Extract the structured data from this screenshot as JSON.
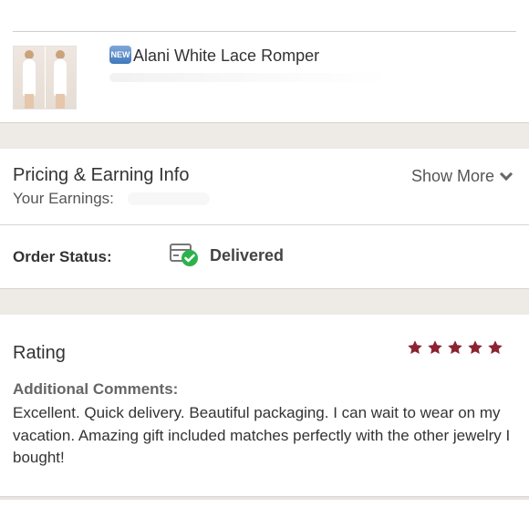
{
  "product": {
    "badge": "NEW",
    "title": "Alani White Lace Romper"
  },
  "pricing": {
    "title": "Pricing & Earning Info",
    "earnings_label": "Your Earnings:",
    "show_more_label": "Show More"
  },
  "order": {
    "status_label": "Order Status:",
    "status_value": "Delivered",
    "status_icon": "package-delivered-icon",
    "status_color": "#2bb24c"
  },
  "rating": {
    "title": "Rating",
    "stars": 5,
    "max_stars": 5,
    "star_color": "#8b2331",
    "comments_label": "Additional Comments:",
    "comments_text": "Excellent. Quick delivery. Beautiful packaging. I can wait to wear on my vacation. Amazing gift included matches perfectly with the other jewelry I bought!"
  }
}
